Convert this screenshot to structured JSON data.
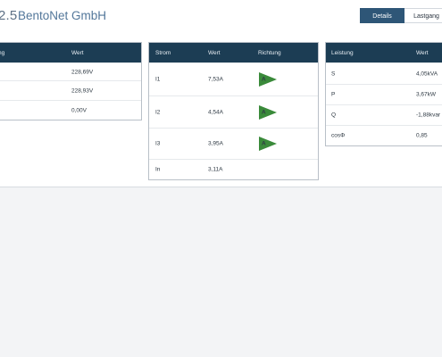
{
  "header": {
    "id_fragment": "2.5",
    "company": "BentoNet GmbH",
    "tabs": {
      "details": "Details",
      "lastgang": "Lastgang"
    }
  },
  "voltage_panel": {
    "headers": {
      "name": "ng",
      "value": "Wert"
    },
    "rows": [
      {
        "value": "228,69V"
      },
      {
        "value": "228,93V"
      },
      {
        "value": "0,00V"
      }
    ]
  },
  "current_panel": {
    "headers": {
      "name": "Strom",
      "value": "Wert",
      "direction": "Richtung"
    },
    "rows": [
      {
        "name": "I1",
        "value": "7,53A",
        "direction": "A"
      },
      {
        "name": "I2",
        "value": "4,54A",
        "direction": "A"
      },
      {
        "name": "I3",
        "value": "3,95A",
        "direction": "A"
      },
      {
        "name": "In",
        "value": "3,11A",
        "direction": ""
      }
    ]
  },
  "power_panel": {
    "headers": {
      "name": "Leistung",
      "value": "Wert"
    },
    "rows": [
      {
        "name": "S",
        "value": "4,05kVA"
      },
      {
        "name": "P",
        "value": "3,67kW"
      },
      {
        "name": "Q",
        "value": "-1,88kvar"
      },
      {
        "name": "cosΦ",
        "value": "0,85"
      }
    ]
  },
  "colors": {
    "table_header_bg": "#1c3d54",
    "active_tab_bg": "#2e5677",
    "direction_arrow": "#3a8a3a",
    "company_text": "#53779a"
  },
  "icons": {
    "direction": "direction-arrow-right-icon"
  }
}
